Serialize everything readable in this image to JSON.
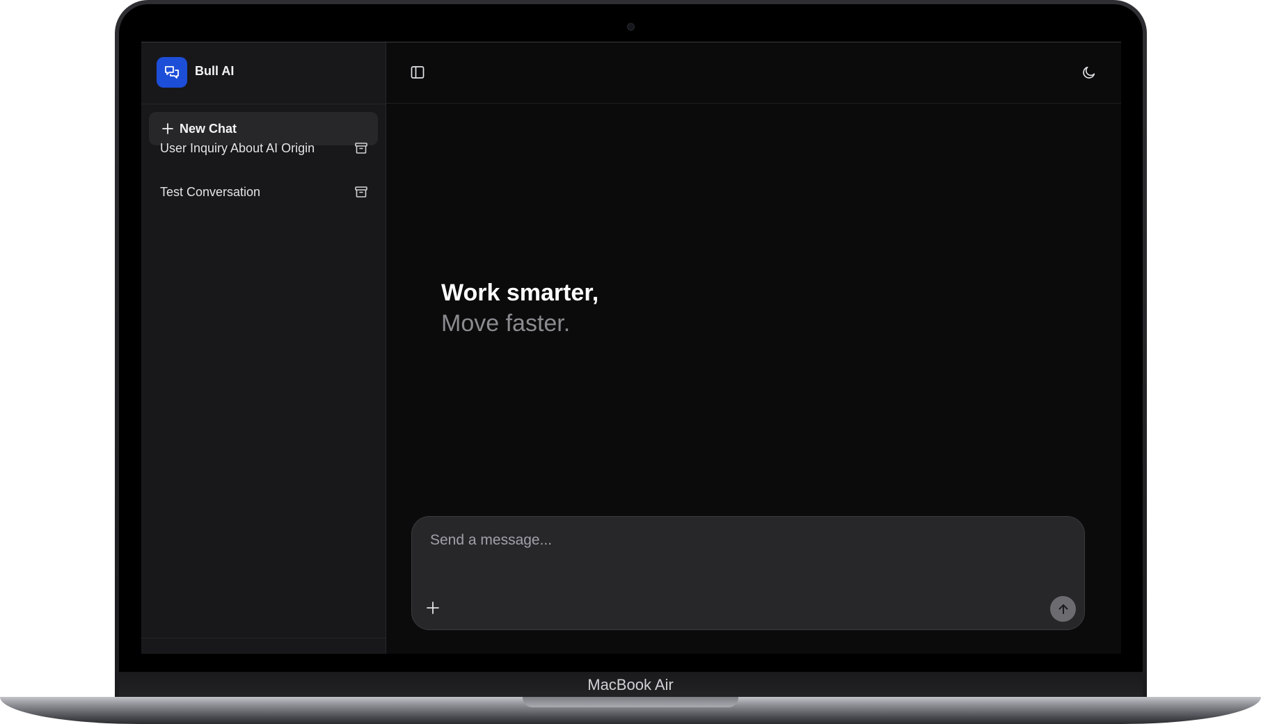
{
  "device": {
    "label": "MacBook Air"
  },
  "sidebar": {
    "app_name": "Bull AI",
    "logo_icon": "chat-bubbles-icon",
    "new_chat_label": "New Chat",
    "chats": [
      {
        "title": "User Inquiry About AI Origin",
        "action_icon": "archive-icon"
      },
      {
        "title": "Test Conversation",
        "action_icon": "archive-icon"
      }
    ]
  },
  "header": {
    "toggle_icon": "sidebar-toggle-icon",
    "theme_icon": "moon-icon"
  },
  "hero": {
    "line1": "Work smarter,",
    "line2": "Move faster."
  },
  "composer": {
    "placeholder": "Send a message...",
    "attach_icon": "plus-icon",
    "send_icon": "arrow-up-icon"
  },
  "colors": {
    "accent": "#1d4ed8",
    "sidebar_bg": "#18181b",
    "main_bg": "#0b0b0c",
    "composer_bg": "#27272a"
  }
}
